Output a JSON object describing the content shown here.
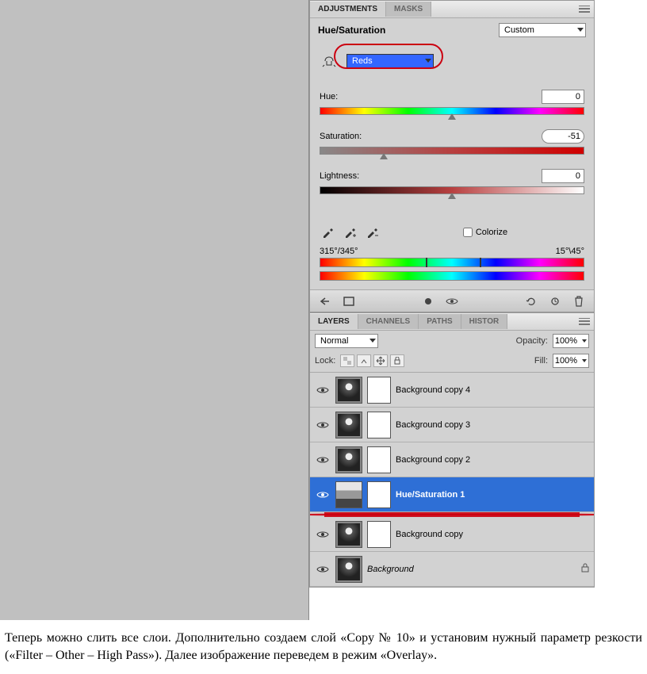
{
  "adjustments": {
    "tabs": {
      "adjustments": "ADJUSTMENTS",
      "masks": "MASKS"
    },
    "title": "Hue/Saturation",
    "preset_label": "Custom",
    "range": "Reds",
    "hue": {
      "label": "Hue:",
      "value": "0"
    },
    "saturation": {
      "label": "Saturation:",
      "value": "-51"
    },
    "lightness": {
      "label": "Lightness:",
      "value": "0"
    },
    "colorize_label": "Colorize",
    "range_left": "315°/345°",
    "range_right": "15°\\45°"
  },
  "layers": {
    "tabs": {
      "layers": "LAYERS",
      "channels": "CHANNELS",
      "paths": "PATHS",
      "history": "HISTOR"
    },
    "blend_mode": "Normal",
    "opacity_label": "Opacity:",
    "opacity_value": "100%",
    "lock_label": "Lock:",
    "fill_label": "Fill:",
    "fill_value": "100%",
    "items": [
      {
        "name": "Background copy 4",
        "adj": false,
        "bg": false,
        "selected": false
      },
      {
        "name": "Background copy 3",
        "adj": false,
        "bg": false,
        "selected": false
      },
      {
        "name": "Background copy 2",
        "adj": false,
        "bg": false,
        "selected": false
      },
      {
        "name": "Hue/Saturation 1",
        "adj": true,
        "bg": false,
        "selected": true
      },
      {
        "name": "Background copy",
        "adj": false,
        "bg": false,
        "selected": false
      },
      {
        "name": "Background",
        "adj": false,
        "bg": true,
        "selected": false
      }
    ]
  },
  "document_text": "Теперь можно слить все слои. Дополнительно создаем слой «Copy № 10» и установим нужный параметр резкости («Filter – Other – High Pass»). Далее изображение переведем в режим «Overlay»."
}
